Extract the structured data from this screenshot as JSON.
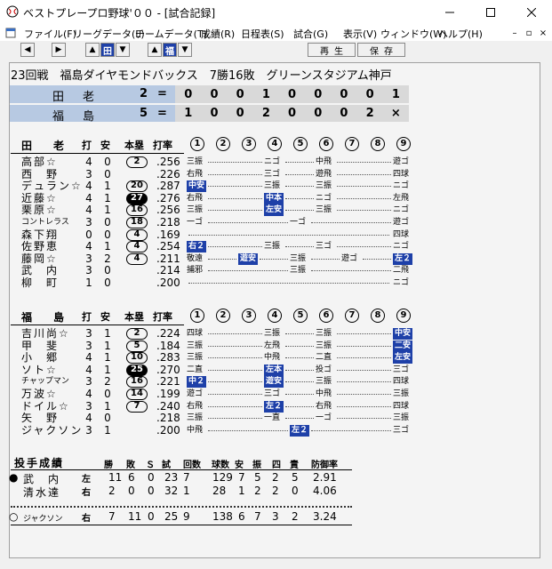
{
  "window": {
    "title": "ベストプレープロ野球'００ - [試合記録]"
  },
  "menu": [
    "ファイル(F)",
    "リーグデータ(L)",
    "チームデータ(T)",
    "成績(R)",
    "日程表(S)",
    "試合(G)",
    "表示(V)",
    "ウィンドウ(W)",
    "ヘルプ(H)"
  ],
  "toolbar": {
    "team1": "田",
    "team2": "福",
    "replay": "再生",
    "save": "保存"
  },
  "game": {
    "header": "23回戦　福島ダイヤモンドバックス　7勝16敗　グリーンスタジアム神戸"
  },
  "linescore": [
    {
      "team": "田　老",
      "runs": "2",
      "eq": "=",
      "innings": [
        "0",
        "0",
        "0",
        "1",
        "0",
        "0",
        "0",
        "0",
        "1"
      ]
    },
    {
      "team": "福　島",
      "runs": "5",
      "eq": "=",
      "innings": [
        "1",
        "0",
        "0",
        "2",
        "0",
        "0",
        "0",
        "2",
        "×"
      ]
    }
  ],
  "columns": {
    "ab": "打",
    "h": "安",
    "hr": "本塁",
    "avg": "打率",
    "innings": [
      "1",
      "2",
      "3",
      "4",
      "5",
      "6",
      "7",
      "8",
      "9"
    ]
  },
  "away": {
    "team": "田　老",
    "batters": [
      {
        "name": "高部☆",
        "ab": "4",
        "h": "0",
        "hr": "2",
        "hrstyle": "o",
        "avg": ".256",
        "pa": [
          [
            "三振",
            0
          ],
          [
            "ニゴ",
            0
          ],
          [
            "中飛",
            0
          ],
          [
            "遊ゴ",
            0
          ]
        ]
      },
      {
        "name": "西　野",
        "ab": "3",
        "h": "0",
        "hr": "",
        "hrstyle": "",
        "avg": ".226",
        "pa": [
          [
            "右飛",
            0
          ],
          [
            "三ゴ",
            0
          ],
          [
            "遊飛",
            0
          ],
          [
            "四球",
            0
          ]
        ]
      },
      {
        "name": "デュラン☆",
        "ab": "4",
        "h": "1",
        "hr": "20",
        "hrstyle": "o",
        "avg": ".287",
        "pa": [
          [
            "中安",
            1
          ],
          [
            "三振",
            0
          ],
          [
            "三振",
            0
          ],
          [
            "ニゴ",
            0
          ]
        ]
      },
      {
        "name": "近藤☆",
        "ab": "4",
        "h": "1",
        "hr": "27",
        "hrstyle": "f",
        "avg": ".276",
        "pa": [
          [
            "右飛",
            0
          ],
          [
            "中本",
            1
          ],
          [
            "ニゴ",
            0
          ],
          [
            "左飛",
            0
          ]
        ]
      },
      {
        "name": "栗原☆",
        "ab": "4",
        "h": "1",
        "hr": "16",
        "hrstyle": "o",
        "avg": ".256",
        "pa": [
          [
            "三振",
            0
          ],
          [
            "左安",
            1
          ],
          [
            "三振",
            0
          ],
          [
            "ニゴ",
            0
          ]
        ]
      },
      {
        "name": "コントレラス",
        "ab": "3",
        "h": "0",
        "hr": "18",
        "hrstyle": "o",
        "avg": ".218",
        "pa": [
          [
            "一ゴ",
            0
          ],
          [
            "一ゴ",
            0
          ],
          [
            "遊ゴ",
            0
          ]
        ]
      },
      {
        "name": "森下翔",
        "ab": "0",
        "h": "0",
        "hr": "4",
        "hrstyle": "o",
        "avg": ".169",
        "pa": [
          [
            "四球",
            0
          ]
        ]
      },
      {
        "name": "佐野恵",
        "ab": "4",
        "h": "1",
        "hr": "4",
        "hrstyle": "o",
        "avg": ".254",
        "pa": [
          [
            "右２",
            1
          ],
          [
            "三振",
            0
          ],
          [
            "三ゴ",
            0
          ],
          [
            "ニゴ",
            0
          ]
        ]
      },
      {
        "name": "藤岡☆",
        "ab": "3",
        "h": "2",
        "hr": "4",
        "hrstyle": "o",
        "avg": ".211",
        "pa": [
          [
            "敬遠",
            0
          ],
          [
            "遊安",
            1
          ],
          [
            "三振",
            0
          ],
          [
            "遊ゴ",
            0
          ],
          [
            "左２",
            1
          ]
        ]
      },
      {
        "name": "武　内",
        "ab": "3",
        "h": "0",
        "hr": "",
        "hrstyle": "",
        "avg": ".214",
        "pa": [
          [
            "捕邪",
            0
          ],
          [
            "三振",
            0
          ],
          [
            "二飛",
            0
          ]
        ]
      },
      {
        "name": "柳　町",
        "ab": "1",
        "h": "0",
        "hr": "",
        "hrstyle": "",
        "avg": ".200",
        "pa": [
          [
            "ニゴ",
            0
          ]
        ]
      }
    ]
  },
  "home": {
    "team": "福　島",
    "batters": [
      {
        "name": "吉川尚☆",
        "ab": "3",
        "h": "1",
        "hr": "2",
        "hrstyle": "o",
        "avg": ".224",
        "pa": [
          [
            "四球",
            0
          ],
          [
            "三振",
            0
          ],
          [
            "三振",
            0
          ],
          [
            "中安",
            1
          ]
        ]
      },
      {
        "name": "甲　斐",
        "ab": "3",
        "h": "1",
        "hr": "5",
        "hrstyle": "o",
        "avg": ".184",
        "pa": [
          [
            "三振",
            0
          ],
          [
            "左飛",
            0
          ],
          [
            "三振",
            0
          ],
          [
            "二安",
            1
          ]
        ]
      },
      {
        "name": "小　郷",
        "ab": "4",
        "h": "1",
        "hr": "10",
        "hrstyle": "o",
        "avg": ".283",
        "pa": [
          [
            "三振",
            0
          ],
          [
            "中飛",
            0
          ],
          [
            "二直",
            0
          ],
          [
            "左安",
            1
          ]
        ]
      },
      {
        "name": "ソト☆",
        "ab": "4",
        "h": "1",
        "hr": "25",
        "hrstyle": "f",
        "avg": ".270",
        "pa": [
          [
            "二直",
            0
          ],
          [
            "左本",
            1
          ],
          [
            "投ゴ",
            0
          ],
          [
            "三ゴ",
            0
          ]
        ]
      },
      {
        "name": "チャップマン",
        "ab": "3",
        "h": "2",
        "hr": "16",
        "hrstyle": "o",
        "avg": ".221",
        "pa": [
          [
            "中２",
            1
          ],
          [
            "遊安",
            1
          ],
          [
            "三振",
            0
          ],
          [
            "四球",
            0
          ]
        ]
      },
      {
        "name": "万波☆",
        "ab": "4",
        "h": "0",
        "hr": "14",
        "hrstyle": "o",
        "avg": ".199",
        "pa": [
          [
            "遊ゴ",
            0
          ],
          [
            "三ゴ",
            0
          ],
          [
            "中飛",
            0
          ],
          [
            "三振",
            0
          ]
        ]
      },
      {
        "name": "ドイル☆",
        "ab": "3",
        "h": "1",
        "hr": "7",
        "hrstyle": "o",
        "avg": ".240",
        "pa": [
          [
            "右飛",
            0
          ],
          [
            "左２",
            1
          ],
          [
            "右飛",
            0
          ],
          [
            "四球",
            0
          ]
        ]
      },
      {
        "name": "矢　野",
        "ab": "4",
        "h": "0",
        "hr": "",
        "hrstyle": "",
        "avg": ".218",
        "pa": [
          [
            "三振",
            0
          ],
          [
            "一直",
            0
          ],
          [
            "一ゴ",
            0
          ],
          [
            "三振",
            0
          ]
        ]
      },
      {
        "name": "ジャクソン",
        "ab": "3",
        "h": "1",
        "hr": "",
        "hrstyle": "",
        "avg": ".200",
        "pa": [
          [
            "中飛",
            0
          ],
          [
            "左２",
            1
          ],
          [
            "三ゴ",
            0
          ]
        ]
      }
    ]
  },
  "pitching": {
    "title": "投手成績",
    "headers": [
      "勝",
      "敗",
      "Ｓ",
      "試",
      "回数",
      "球数",
      "安",
      "振",
      "四",
      "責",
      "防御率"
    ],
    "rows": [
      {
        "mark": "●",
        "name": "武　内",
        "hand": "左",
        "vals": [
          "11",
          "6",
          "0",
          "23",
          "7",
          "129",
          "7",
          "5",
          "2",
          "5",
          "2.91"
        ]
      },
      {
        "mark": "",
        "name": "清水達",
        "hand": "右",
        "vals": [
          "2",
          "0",
          "0",
          "32",
          "1",
          "28",
          "1",
          "2",
          "2",
          "0",
          "4.06"
        ]
      },
      {
        "mark": "○",
        "name": "ジャクソン",
        "hand": "右",
        "vals": [
          "7",
          "11",
          "0",
          "25",
          "9",
          "138",
          "6",
          "7",
          "3",
          "2",
          "3.24"
        ]
      }
    ]
  }
}
